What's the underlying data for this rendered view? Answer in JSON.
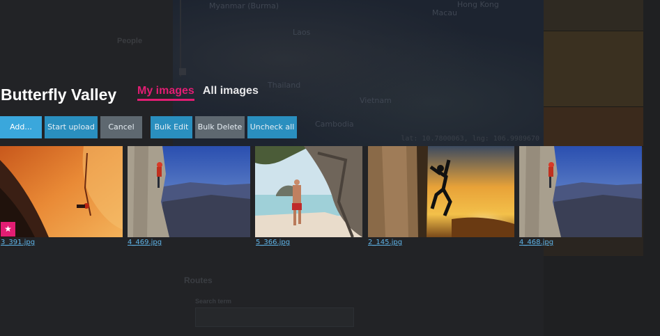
{
  "page_title": "Butterfly Valley",
  "tabs": [
    {
      "label": "My images",
      "active": true
    },
    {
      "label": "All images",
      "active": false
    }
  ],
  "toolbar": {
    "add_label": "Add...",
    "start_upload_label": "Start upload",
    "cancel_label": "Cancel",
    "bulk_edit_label": "Bulk Edit",
    "bulk_delete_label": "Bulk Delete",
    "uncheck_all_label": "Uncheck all"
  },
  "images": [
    {
      "filename": "3_391.jpg",
      "featured": true
    },
    {
      "filename": "4_469.jpg",
      "featured": false
    },
    {
      "filename": "5_366.jpg",
      "featured": false
    },
    {
      "filename": "2_145.jpg",
      "featured": false
    },
    {
      "filename": "4_468.jpg",
      "featured": false
    }
  ],
  "background": {
    "people_label": "People",
    "routes_label": "Routes",
    "search_term_label": "Search term",
    "map_labels": [
      "Myanmar (Burma)",
      "Laos",
      "Thailand",
      "Vietnam",
      "Cambodia",
      "Macau",
      "Hong Kong"
    ],
    "coords": "lat: 10.7800063, lng: 106.9989670"
  },
  "colors": {
    "accent": "#e21d73",
    "button_blue": "#2a8fbf",
    "button_grey": "#5e6870",
    "link": "#5fb3e6"
  }
}
